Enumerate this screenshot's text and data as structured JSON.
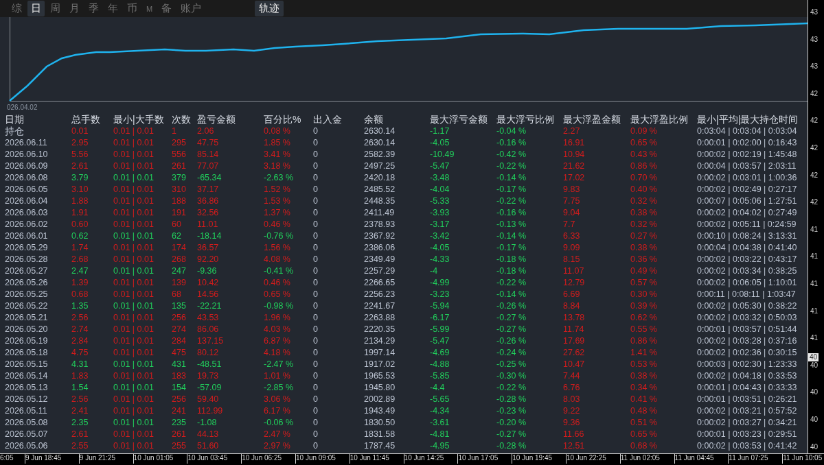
{
  "tabs": [
    {
      "label": "综",
      "selected": false
    },
    {
      "label": "日",
      "selected": true
    },
    {
      "label": "周",
      "selected": false
    },
    {
      "label": "月",
      "selected": false
    },
    {
      "label": "季",
      "selected": false
    },
    {
      "label": "年",
      "selected": false
    },
    {
      "label": "币",
      "selected": false
    },
    {
      "label": "M",
      "selected": false
    },
    {
      "label": "备",
      "selected": false
    },
    {
      "label": "账户",
      "selected": false
    }
  ],
  "trail_button": {
    "label": "轨迹",
    "selected": true
  },
  "chart": {
    "start_label": "026.04.02"
  },
  "table": {
    "columns": [
      "日期",
      "总手数",
      "最小|大手数",
      "次数",
      "盈亏金额",
      "百分比%",
      "出入金",
      "余额",
      "最大浮亏金额",
      "最大浮亏比例",
      "最大浮盈金额",
      "最大浮盈比例",
      "最小|平均|最大持仓时间"
    ],
    "rows": [
      {
        "kind": "gain",
        "cells": [
          "持仓",
          "0.01",
          "0.01 | 0.01",
          "1",
          "2.06",
          "0.08 %",
          "0",
          "2630.14",
          "-1.17",
          "-0.04 %",
          "2.27",
          "0.09 %",
          "0:03:04 | 0:03:04 | 0:03:04"
        ]
      },
      {
        "kind": "gain",
        "cells": [
          "2026.06.11",
          "2.95",
          "0.01 | 0.01",
          "295",
          "47.75",
          "1.85 %",
          "0",
          "2630.14",
          "-4.05",
          "-0.16 %",
          "16.91",
          "0.65 %",
          "0:00:01 | 0:02:00 | 0:16:43"
        ]
      },
      {
        "kind": "gain",
        "cells": [
          "2026.06.10",
          "5.56",
          "0.01 | 0.01",
          "556",
          "85.14",
          "3.41 %",
          "0",
          "2582.39",
          "-10.49",
          "-0.42 %",
          "10.94",
          "0.43 %",
          "0:00:02 | 0:02:19 | 1:45:48"
        ]
      },
      {
        "kind": "gain",
        "cells": [
          "2026.06.09",
          "2.61",
          "0.01 | 0.01",
          "261",
          "77.07",
          "3.18 %",
          "0",
          "2497.25",
          "-5.47",
          "-0.22 %",
          "21.62",
          "0.86 %",
          "0:00:04 | 0:03:57 | 2:03:11"
        ]
      },
      {
        "kind": "loss",
        "cells": [
          "2026.06.08",
          "3.79",
          "0.01 | 0.01",
          "379",
          "-65.34",
          "-2.63 %",
          "0",
          "2420.18",
          "-3.48",
          "-0.14 %",
          "17.02",
          "0.70 %",
          "0:00:02 | 0:03:01 | 1:00:36"
        ]
      },
      {
        "kind": "gain",
        "cells": [
          "2026.06.05",
          "3.10",
          "0.01 | 0.01",
          "310",
          "37.17",
          "1.52 %",
          "0",
          "2485.52",
          "-4.04",
          "-0.17 %",
          "9.83",
          "0.40 %",
          "0:00:02 | 0:02:49 | 0:27:17"
        ]
      },
      {
        "kind": "gain",
        "cells": [
          "2026.06.04",
          "1.88",
          "0.01 | 0.01",
          "188",
          "36.86",
          "1.53 %",
          "0",
          "2448.35",
          "-5.33",
          "-0.22 %",
          "7.75",
          "0.32 %",
          "0:00:07 | 0:05:06 | 1:27:51"
        ]
      },
      {
        "kind": "gain",
        "cells": [
          "2026.06.03",
          "1.91",
          "0.01 | 0.01",
          "191",
          "32.56",
          "1.37 %",
          "0",
          "2411.49",
          "-3.93",
          "-0.16 %",
          "9.04",
          "0.38 %",
          "0:00:02 | 0:04:02 | 0:27:49"
        ]
      },
      {
        "kind": "gain",
        "cells": [
          "2026.06.02",
          "0.60",
          "0.01 | 0.01",
          "60",
          "11.01",
          "0.46 %",
          "0",
          "2378.93",
          "-3.17",
          "-0.13 %",
          "7.7",
          "0.32 %",
          "0:00:02 | 0:05:11 | 0:24:59"
        ]
      },
      {
        "kind": "loss",
        "cells": [
          "2026.06.01",
          "0.62",
          "0.01 | 0.01",
          "62",
          "-18.14",
          "-0.76 %",
          "0",
          "2367.92",
          "-3.42",
          "-0.14 %",
          "6.33",
          "0.27 %",
          "0:00:10 | 0:08:24 | 3:13:31"
        ]
      },
      {
        "kind": "gain",
        "cells": [
          "2026.05.29",
          "1.74",
          "0.01 | 0.01",
          "174",
          "36.57",
          "1.56 %",
          "0",
          "2386.06",
          "-4.05",
          "-0.17 %",
          "9.09",
          "0.38 %",
          "0:00:04 | 0:04:38 | 0:41:40"
        ]
      },
      {
        "kind": "gain",
        "cells": [
          "2026.05.28",
          "2.68",
          "0.01 | 0.01",
          "268",
          "92.20",
          "4.08 %",
          "0",
          "2349.49",
          "-4.33",
          "-0.18 %",
          "8.15",
          "0.36 %",
          "0:00:02 | 0:03:22 | 0:43:17"
        ]
      },
      {
        "kind": "loss",
        "cells": [
          "2026.05.27",
          "2.47",
          "0.01 | 0.01",
          "247",
          "-9.36",
          "-0.41 %",
          "0",
          "2257.29",
          "-4",
          "-0.18 %",
          "11.07",
          "0.49 %",
          "0:00:02 | 0:03:34 | 0:38:25"
        ]
      },
      {
        "kind": "gain",
        "cells": [
          "2026.05.26",
          "1.39",
          "0.01 | 0.01",
          "139",
          "10.42",
          "0.46 %",
          "0",
          "2266.65",
          "-4.99",
          "-0.22 %",
          "12.79",
          "0.57 %",
          "0:00:02 | 0:06:05 | 1:10:01"
        ]
      },
      {
        "kind": "gain",
        "cells": [
          "2026.05.25",
          "0.68",
          "0.01 | 0.01",
          "68",
          "14.56",
          "0.65 %",
          "0",
          "2256.23",
          "-3.23",
          "-0.14 %",
          "6.69",
          "0.30 %",
          "0:00:11 | 0:08:11 | 1:03:47"
        ]
      },
      {
        "kind": "loss",
        "cells": [
          "2026.05.22",
          "1.35",
          "0.01 | 0.01",
          "135",
          "-22.21",
          "-0.98 %",
          "0",
          "2241.67",
          "-5.94",
          "-0.26 %",
          "8.84",
          "0.39 %",
          "0:00:02 | 0:05:30 | 0:38:22"
        ]
      },
      {
        "kind": "gain",
        "cells": [
          "2026.05.21",
          "2.56",
          "0.01 | 0.01",
          "256",
          "43.53",
          "1.96 %",
          "0",
          "2263.88",
          "-6.17",
          "-0.27 %",
          "13.78",
          "0.62 %",
          "0:00:02 | 0:03:32 | 0:50:03"
        ]
      },
      {
        "kind": "gain",
        "cells": [
          "2026.05.20",
          "2.74",
          "0.01 | 0.01",
          "274",
          "86.06",
          "4.03 %",
          "0",
          "2220.35",
          "-5.99",
          "-0.27 %",
          "11.74",
          "0.55 %",
          "0:00:01 | 0:03:57 | 0:51:44"
        ]
      },
      {
        "kind": "gain",
        "cells": [
          "2026.05.19",
          "2.84",
          "0.01 | 0.01",
          "284",
          "137.15",
          "6.87 %",
          "0",
          "2134.29",
          "-5.47",
          "-0.26 %",
          "17.69",
          "0.86 %",
          "0:00:02 | 0:03:28 | 0:37:16"
        ]
      },
      {
        "kind": "gain",
        "cells": [
          "2026.05.18",
          "4.75",
          "0.01 | 0.01",
          "475",
          "80.12",
          "4.18 %",
          "0",
          "1997.14",
          "-4.69",
          "-0.24 %",
          "27.62",
          "1.41 %",
          "0:00:02 | 0:02:36 | 0:30:15"
        ]
      },
      {
        "kind": "loss",
        "cells": [
          "2026.05.15",
          "4.31",
          "0.01 | 0.01",
          "431",
          "-48.51",
          "-2.47 %",
          "0",
          "1917.02",
          "-4.88",
          "-0.25 %",
          "10.47",
          "0.53 %",
          "0:00:03 | 0:02:30 | 1:23:33"
        ]
      },
      {
        "kind": "gain",
        "cells": [
          "2026.05.14",
          "1.83",
          "0.01 | 0.01",
          "183",
          "19.73",
          "1.01 %",
          "0",
          "1965.53",
          "-5.85",
          "-0.30 %",
          "7.44",
          "0.38 %",
          "0:00:02 | 0:04:18 | 0:33:53"
        ]
      },
      {
        "kind": "loss",
        "cells": [
          "2026.05.13",
          "1.54",
          "0.01 | 0.01",
          "154",
          "-57.09",
          "-2.85 %",
          "0",
          "1945.80",
          "-4.4",
          "-0.22 %",
          "6.76",
          "0.34 %",
          "0:00:01 | 0:04:43 | 0:33:33"
        ]
      },
      {
        "kind": "gain",
        "cells": [
          "2026.05.12",
          "2.56",
          "0.01 | 0.01",
          "256",
          "59.40",
          "3.06 %",
          "0",
          "2002.89",
          "-5.65",
          "-0.28 %",
          "8.03",
          "0.41 %",
          "0:00:01 | 0:03:51 | 0:26:21"
        ]
      },
      {
        "kind": "gain",
        "cells": [
          "2026.05.11",
          "2.41",
          "0.01 | 0.01",
          "241",
          "112.99",
          "6.17 %",
          "0",
          "1943.49",
          "-4.34",
          "-0.23 %",
          "9.22",
          "0.48 %",
          "0:00:02 | 0:03:21 | 0:57:52"
        ]
      },
      {
        "kind": "loss",
        "cells": [
          "2026.05.08",
          "2.35",
          "0.01 | 0.01",
          "235",
          "-1.08",
          "-0.06 %",
          "0",
          "1830.50",
          "-3.61",
          "-0.20 %",
          "9.36",
          "0.51 %",
          "0:00:02 | 0:03:27 | 0:34:21"
        ]
      },
      {
        "kind": "gain",
        "cells": [
          "2026.05.07",
          "2.61",
          "0.01 | 0.01",
          "261",
          "44.13",
          "2.47 %",
          "0",
          "1831.58",
          "-4.81",
          "-0.27 %",
          "11.66",
          "0.65 %",
          "0:00:01 | 0:03:23 | 0:29:51"
        ]
      },
      {
        "kind": "gain",
        "cells": [
          "2026.05.06",
          "2.55",
          "0.01 | 0.01",
          "255",
          "51.60",
          "2.97 %",
          "0",
          "1787.45",
          "-4.95",
          "-0.28 %",
          "12.51",
          "0.68 %",
          "0:00:02 | 0:03:53 | 0:41:42"
        ]
      }
    ]
  },
  "price_axis": {
    "ticks": [
      "43",
      "43",
      "43",
      "42",
      "42",
      "42",
      "42",
      "42",
      "41",
      "41",
      "41",
      "41",
      "41",
      "40",
      "40",
      "40",
      "40"
    ],
    "current": "40"
  },
  "time_axis": [
    "6:05",
    "9 Jun 18:45",
    "9 Jun 21:25",
    "10 Jun 01:05",
    "10 Jun 03:45",
    "10 Jun 06:25",
    "10 Jun 09:05",
    "10 Jun 11:45",
    "10 Jun 14:25",
    "10 Jun 17:05",
    "10 Jun 19:45",
    "10 Jun 22:25",
    "11 Jun 02:05",
    "11 Jun 04:45",
    "11 Jun 07:25",
    "11 Jun 10:05"
  ]
}
